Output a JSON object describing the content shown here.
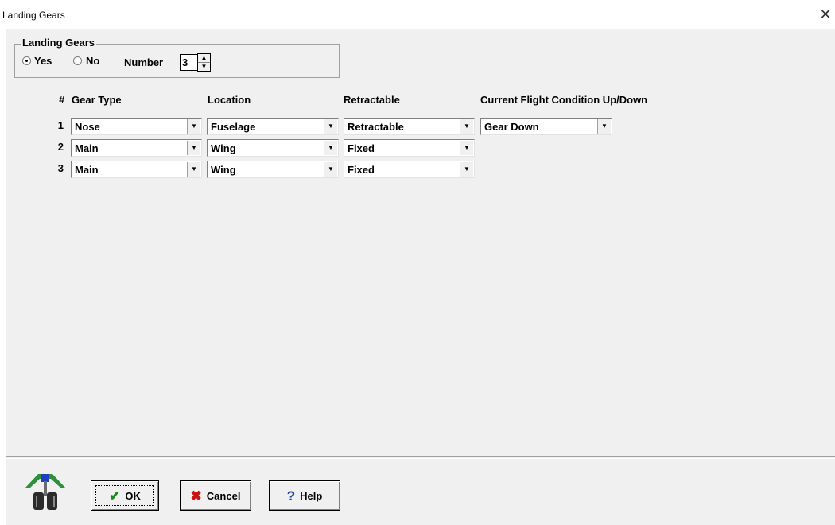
{
  "window": {
    "title": "Landing Gears",
    "close_glyph": "✕"
  },
  "landing_gears_group": {
    "label": "Landing Gears",
    "yes_label": "Yes",
    "no_label": "No",
    "selected": "Yes",
    "number_label": "Number",
    "number_value": "3"
  },
  "table": {
    "headers": {
      "num": "#",
      "gear_type": "Gear Type",
      "location": "Location",
      "retractable": "Retractable",
      "flight_condition": "Current Flight Condition Up/Down"
    },
    "rows": [
      {
        "num": "1",
        "gear_type": "Nose",
        "location": "Fuselage",
        "retractable": "Retractable",
        "flight_condition": "Gear Down"
      },
      {
        "num": "2",
        "gear_type": "Main",
        "location": "Wing",
        "retractable": "Fixed"
      },
      {
        "num": "3",
        "gear_type": "Main",
        "location": "Wing",
        "retractable": "Fixed"
      }
    ]
  },
  "buttons": {
    "ok": {
      "label": "OK",
      "icon": "checkmark-icon",
      "color": "#1a8a1a"
    },
    "cancel": {
      "label": "Cancel",
      "icon": "red-x-icon",
      "color": "#cc1111"
    },
    "help": {
      "label": "Help",
      "icon": "question-icon",
      "color": "#1a3fb5"
    }
  },
  "icons": {
    "dropdown_arrow": "▼",
    "spin_up": "▲",
    "spin_down": "▼",
    "logo": "landing-gear-logo-icon"
  }
}
